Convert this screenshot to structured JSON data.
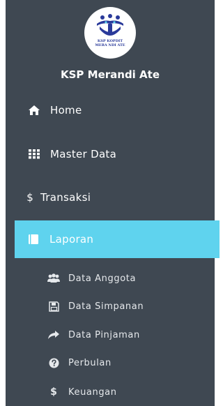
{
  "brand": {
    "logo_line1": "KSP KOPDIT",
    "logo_line2": "MERA NDI ATE",
    "title": "KSP Merandi Ate"
  },
  "menu": [
    {
      "label": "Home",
      "icon": "home-icon"
    },
    {
      "label": "Master Data",
      "icon": "grid-icon"
    },
    {
      "label": "Transaksi",
      "icon": "dollar-icon"
    },
    {
      "label": "Laporan",
      "icon": "book-icon",
      "active": true
    }
  ],
  "submenu": [
    {
      "label": "Data Anggota",
      "icon": "users-icon"
    },
    {
      "label": "Data Simpanan",
      "icon": "save-icon"
    },
    {
      "label": "Data Pinjaman",
      "icon": "share-arrow-icon"
    },
    {
      "label": "Perbulan",
      "icon": "question-circle-icon"
    },
    {
      "label": "Keuangan",
      "icon": "dollar-icon"
    }
  ],
  "colors": {
    "sidebar_bg": "#3f4852",
    "active_bg": "#5fd3ee",
    "text": "#ffffff"
  }
}
